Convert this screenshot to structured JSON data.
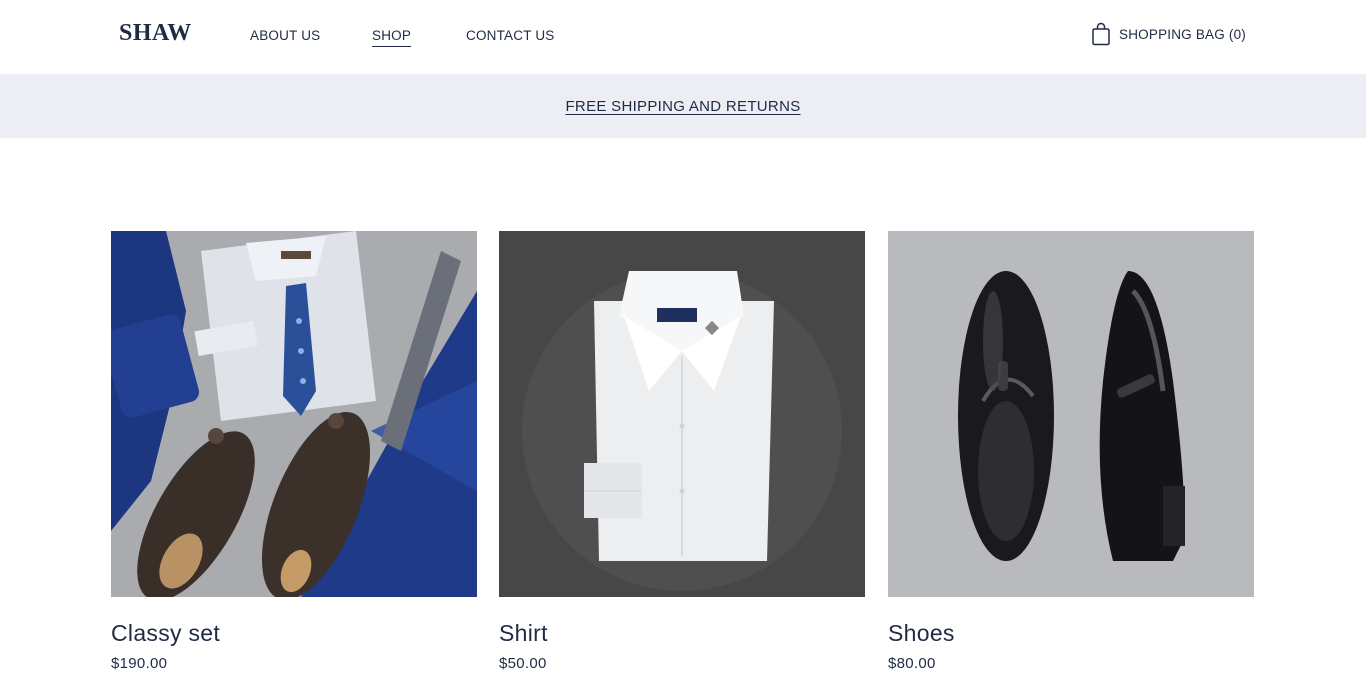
{
  "header": {
    "logo": "SHAW",
    "nav": [
      {
        "label": "ABOUT US"
      },
      {
        "label": "SHOP"
      },
      {
        "label": "CONTACT US"
      }
    ],
    "active_nav": "SHOP",
    "bag_label": "SHOPPING BAG (0)"
  },
  "banner": {
    "text": "FREE SHIPPING AND RETURNS"
  },
  "products": [
    {
      "name": "Classy set",
      "price": "$190.00"
    },
    {
      "name": "Shirt",
      "price": "$50.00"
    },
    {
      "name": "Shoes",
      "price": "$80.00"
    }
  ],
  "colors": {
    "text": "#1f2a44",
    "banner_bg": "#eceef3",
    "suit_blue": "#1e3a8a",
    "shirt_bg_dark": "#474747",
    "shoes_bg": "#b9babd"
  }
}
